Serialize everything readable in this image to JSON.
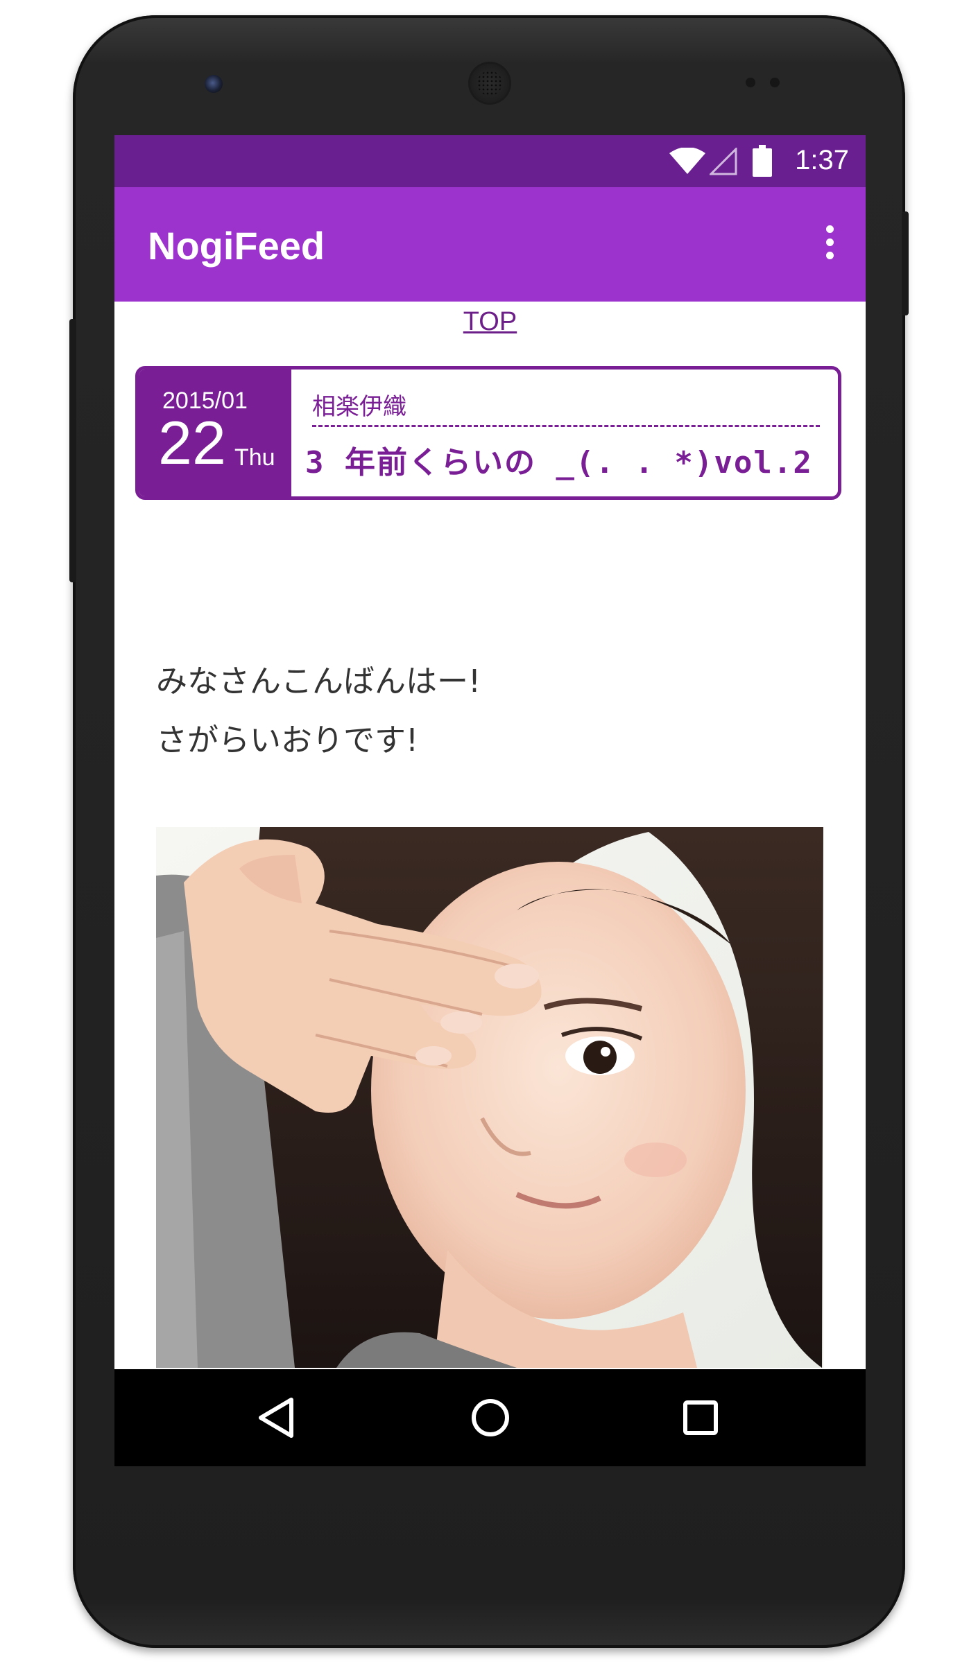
{
  "status_bar": {
    "time": "1:37",
    "icons": [
      "wifi-icon",
      "signal-icon",
      "battery-icon"
    ]
  },
  "app_bar": {
    "title": "NogiFeed",
    "overflow_icon": "more-vert-icon"
  },
  "content": {
    "top_link": "TOP",
    "entry": {
      "year_month": "2015/01",
      "day": "22",
      "weekday": "Thu",
      "author": "相楽伊織",
      "title": "3 年前くらいの _(. . *)vol.2"
    },
    "body_lines": [
      "みなさんこんばんはー!",
      "さがらいおりです!"
    ]
  },
  "nav_bar": {
    "buttons": [
      "back-icon",
      "home-icon",
      "recents-icon"
    ]
  },
  "colors": {
    "status_bar": "#6a1f91",
    "app_bar": "#9b33cc",
    "accent": "#7a1e96"
  }
}
